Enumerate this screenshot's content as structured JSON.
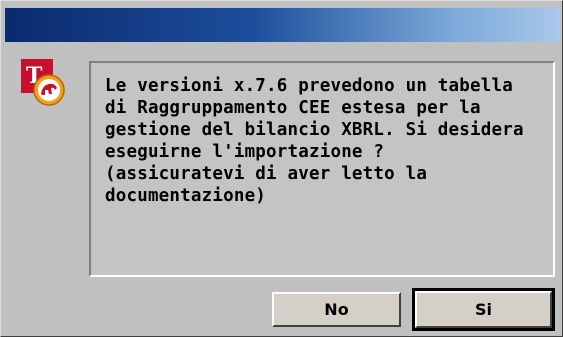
{
  "dialog": {
    "icon": "app-logo-icon",
    "message": "Le versioni x.7.6 prevedono un tabella\ndi Raggruppamento CEE estesa per la\ngestione del bilancio XBRL. Si desidera\neseguirne l'importazione ?\n(assicuratevi di aver letto la\ndocumentazione)"
  },
  "buttons": {
    "no_label": "No",
    "si_label": "Si"
  },
  "colors": {
    "titlebar_start": "#0a2a6e",
    "titlebar_end": "#a9c8ea",
    "dialog_bg": "#c0c0c0"
  }
}
